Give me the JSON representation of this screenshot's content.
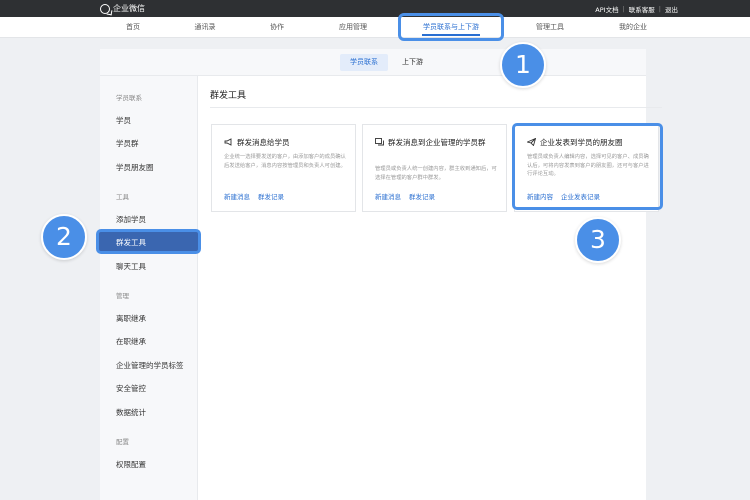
{
  "topbar": {
    "logo_text": "企业微信",
    "links": [
      "API文档",
      "联系客服",
      "退出"
    ]
  },
  "nav": {
    "items": [
      "首页",
      "通讯录",
      "协作",
      "应用管理",
      "学员联系与上下游",
      "管理工具",
      "我的企业"
    ],
    "active_index": 4
  },
  "subtabs": [
    "学员联系",
    "上下游"
  ],
  "sidebar": {
    "group1": "学员联系",
    "group1_items": [
      "学员",
      "学员群",
      "学员朋友圈"
    ],
    "group2": "工具",
    "group2_items": [
      "添加学员",
      "群发工具",
      "聊天工具"
    ],
    "active_item": "群发工具",
    "group3": "管理",
    "group3_items": [
      "离职继承",
      "在职继承",
      "企业管理的学员标签",
      "安全管控",
      "数据统计"
    ],
    "group4": "配置",
    "group4_items": [
      "权限配置"
    ]
  },
  "content": {
    "title": "群发工具",
    "cards": [
      {
        "icon": "megaphone-icon",
        "title": "群发消息给学员",
        "desc": "企业统一选择要发送的客户，由添加客户的成员确认后发送给客户，消息内容按管理员和负责人可创建。",
        "links": [
          "新建消息",
          "群发记录"
        ]
      },
      {
        "icon": "group-message-icon",
        "title": "群发消息到企业管理的学员群",
        "desc": "管理员或负责人统一创建内容，群主收到通知后，可选择在管理的客户群中群发。",
        "links": [
          "新建消息",
          "群发记录"
        ]
      },
      {
        "icon": "paper-plane-icon",
        "title": "企业发表到学员的朋友圈",
        "desc": "管理员或负责人编辑内容，选择可见的客户、成员确认后，可将内容发表到客户的朋友圈，还可与客户进行评论互动。",
        "links": [
          "新建内容",
          "企业发表记录"
        ]
      }
    ]
  },
  "badges": [
    "1",
    "2",
    "3"
  ],
  "colors": {
    "accent": "#4a8fe7",
    "link": "#2a6fd1",
    "topbar": "#2e3033",
    "active_side": "#3a66b0"
  }
}
